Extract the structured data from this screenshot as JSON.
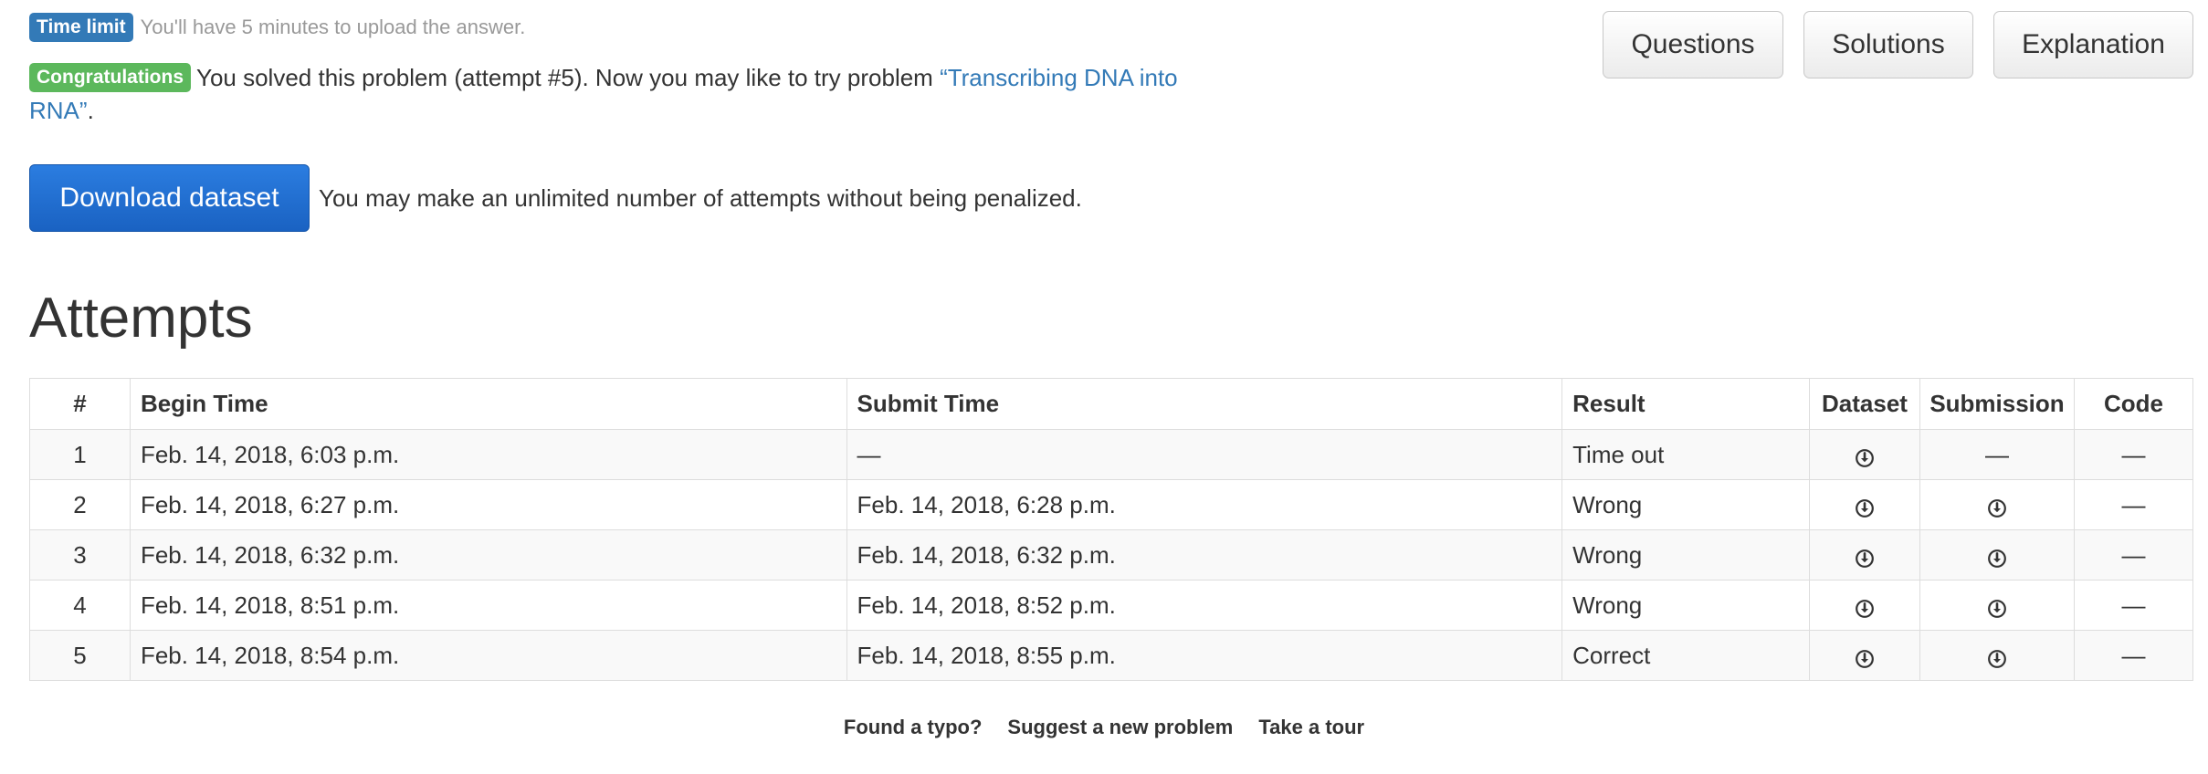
{
  "time_limit": {
    "badge": "Time limit",
    "text": "You'll have 5 minutes to upload the answer."
  },
  "congrats": {
    "badge": "Congratulations",
    "text_before": "You solved this problem (attempt #5). Now you may like to try problem ",
    "link": "“Transcribing DNA into RNA”",
    "text_after": "."
  },
  "download": {
    "button_label": "Download dataset",
    "note": "You may make an unlimited number of attempts without being penalized."
  },
  "top_buttons": {
    "questions": "Questions",
    "solutions": "Solutions",
    "explanation": "Explanation"
  },
  "attempts": {
    "heading": "Attempts",
    "columns": {
      "num": "#",
      "begin": "Begin Time",
      "submit": "Submit Time",
      "result": "Result",
      "dataset": "Dataset",
      "submission": "Submission",
      "code": "Code"
    },
    "rows": [
      {
        "num": "1",
        "begin": "Feb. 14, 2018, 6:03 p.m.",
        "submit": "—",
        "result": "Time out",
        "dataset": "download-icon",
        "submission": "—",
        "code": "—"
      },
      {
        "num": "2",
        "begin": "Feb. 14, 2018, 6:27 p.m.",
        "submit": "Feb. 14, 2018, 6:28 p.m.",
        "result": "Wrong",
        "dataset": "download-icon",
        "submission": "download-icon",
        "code": "—"
      },
      {
        "num": "3",
        "begin": "Feb. 14, 2018, 6:32 p.m.",
        "submit": "Feb. 14, 2018, 6:32 p.m.",
        "result": "Wrong",
        "dataset": "download-icon",
        "submission": "download-icon",
        "code": "—"
      },
      {
        "num": "4",
        "begin": "Feb. 14, 2018, 8:51 p.m.",
        "submit": "Feb. 14, 2018, 8:52 p.m.",
        "result": "Wrong",
        "dataset": "download-icon",
        "submission": "download-icon",
        "code": "—"
      },
      {
        "num": "5",
        "begin": "Feb. 14, 2018, 8:54 p.m.",
        "submit": "Feb. 14, 2018, 8:55 p.m.",
        "result": "Correct",
        "dataset": "download-icon",
        "submission": "download-icon",
        "code": "—"
      }
    ]
  },
  "footer": {
    "typo": "Found a typo?",
    "suggest": "Suggest a new problem",
    "tour": "Take a tour"
  },
  "colors": {
    "info_badge": "#337ab7",
    "success_badge": "#5cb85c",
    "primary_button": "#1f6fcf",
    "link": "#337ab7"
  }
}
